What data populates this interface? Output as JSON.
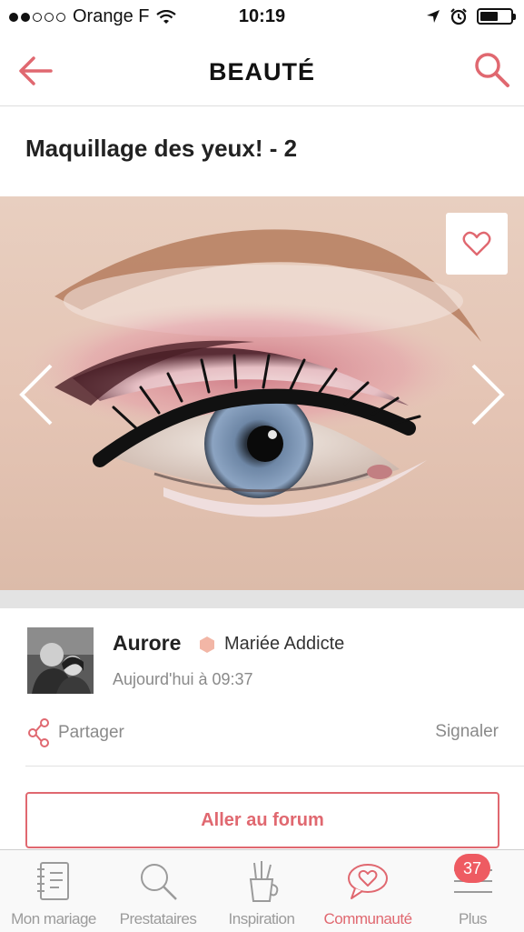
{
  "status_bar": {
    "carrier": "Orange F",
    "time": "10:19",
    "signal_bars_filled": 2,
    "signal_bars_total": 5,
    "battery_level": 0.6
  },
  "header": {
    "title": "BEAUTÉ",
    "back_icon": "back-arrow-icon",
    "search_icon": "search-icon"
  },
  "article": {
    "title": "Maquillage des yeux! - 2"
  },
  "author": {
    "name": "Aurore",
    "rank": "Mariée Addicte",
    "date": "Aujourd'hui à 09:37"
  },
  "actions": {
    "share_label": "Partager",
    "report_label": "Signaler",
    "forum_button": "Aller au forum"
  },
  "tab_bar": {
    "items": [
      {
        "label": "Mon mariage",
        "icon": "notebook-icon"
      },
      {
        "label": "Prestataires",
        "icon": "search-icon"
      },
      {
        "label": "Inspiration",
        "icon": "brushes-icon"
      },
      {
        "label": "Communauté",
        "icon": "chat-heart-icon"
      },
      {
        "label": "Plus",
        "icon": "menu-icon"
      }
    ],
    "active_index": 3,
    "badge_count": "37"
  },
  "colors": {
    "accent": "#e06870",
    "badge": "#ee5b62",
    "muted_text": "#8a8a8a"
  }
}
